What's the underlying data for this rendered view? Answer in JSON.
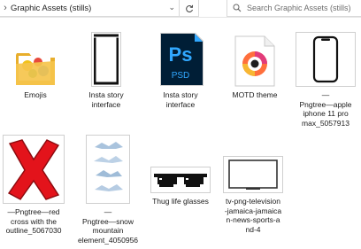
{
  "address_bar": {
    "path": "Graphic Assets (stills)"
  },
  "search": {
    "placeholder": "Search Graphic Assets (stills)"
  },
  "files": [
    {
      "label": "Emojis",
      "type": "folder"
    },
    {
      "label": "Insta story\ninterface",
      "type": "png"
    },
    {
      "label": "Insta story\ninterface",
      "type": "psd",
      "badge": "Ps",
      "badge_sub": "PSD"
    },
    {
      "label": "MOTD theme",
      "type": "audio"
    },
    {
      "label": "—\nPngtree—apple\niphone 11 pro\nmax_5057913",
      "type": "png"
    },
    {
      "label": "—Pngtree—red\ncross with the\noutline_5067030",
      "type": "png"
    },
    {
      "label": "—\nPngtree—snow\nmountain\nelement_4050956",
      "type": "png"
    },
    {
      "label": "Thug life glasses",
      "type": "png"
    },
    {
      "label": "tv-png-television\n-jamaica-jamaica\nn-news-sports-a\nnd-4",
      "type": "png"
    }
  ],
  "colors": {
    "ps_bg": "#001e36",
    "ps_accent": "#31a8ff",
    "cross_red": "#e3131b",
    "folder_yellow": "#f5c44c"
  }
}
